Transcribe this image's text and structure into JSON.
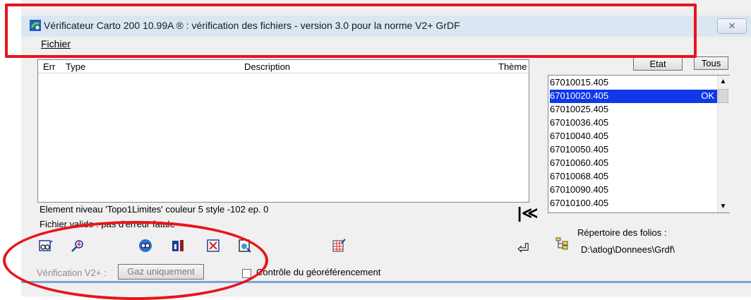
{
  "window": {
    "title": "Vérificateur Carto 200 10.99A ® : vérification des fichiers - version 3.0 pour la norme V2+ GrDF",
    "close_label": "✕"
  },
  "menu": {
    "fichier": "Fichier"
  },
  "error_list": {
    "columns": [
      "Err",
      "Type",
      "Description",
      "Thème"
    ]
  },
  "status": {
    "element_info": "Element niveau 'Topo1Limites' couleur 5 style -102 ep. 0",
    "validity": "Fichier valide : pas d'erreur fatale"
  },
  "files": {
    "etat_label": "Etat",
    "tous_label": "Tous",
    "items": [
      {
        "name": "67010015.405",
        "state": ""
      },
      {
        "name": "67010020.405",
        "state": "OK"
      },
      {
        "name": "67010025.405",
        "state": ""
      },
      {
        "name": "67010036.405",
        "state": ""
      },
      {
        "name": "67010040.405",
        "state": ""
      },
      {
        "name": "67010050.405",
        "state": ""
      },
      {
        "name": "67010060.405",
        "state": ""
      },
      {
        "name": "67010068.405",
        "state": ""
      },
      {
        "name": "67010090.405",
        "state": ""
      },
      {
        "name": "67010100.405",
        "state": ""
      }
    ],
    "selected_index": 1
  },
  "folios": {
    "label": "Répertoire des folios :",
    "path": "D:\\atlog\\Donnees\\Grdf\\"
  },
  "controls": {
    "verification_label": "Vérification V2+ :",
    "gaz_button": "Gaz uniquement",
    "georef_label": "Contrôle du géoréférencement"
  },
  "colors": {
    "annotation_red": "#e8141b",
    "selection_blue": "#0f38e8"
  }
}
